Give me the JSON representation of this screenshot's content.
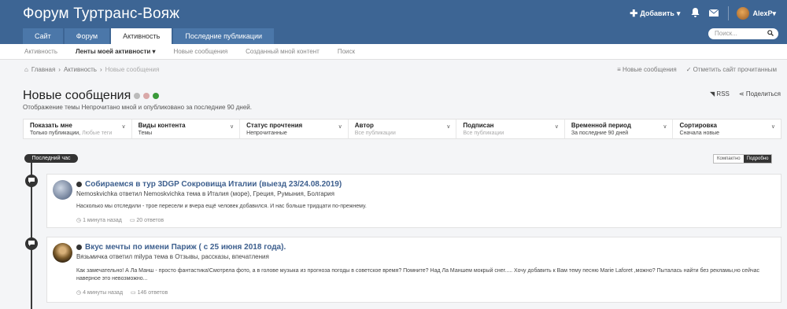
{
  "header": {
    "site_title": "Форум Туртранс-Вояж",
    "add_label": "Добавить",
    "username": "AlexP"
  },
  "nav": {
    "tabs": [
      {
        "label": "Сайт"
      },
      {
        "label": "Форум"
      },
      {
        "label": "Активность"
      },
      {
        "label": "Последние публикации"
      }
    ],
    "search_placeholder": "Поиск..."
  },
  "subnav": {
    "items": [
      {
        "label": "Активность"
      },
      {
        "label": "Ленты моей активности ▾"
      },
      {
        "label": "Новые сообщения"
      },
      {
        "label": "Созданный мной контент"
      },
      {
        "label": "Поиск"
      }
    ]
  },
  "breadcrumb": {
    "home": "Главная",
    "section": "Активность",
    "current": "Новые сообщения",
    "right_new": "Новые сообщения",
    "right_mark_read": "Отметить сайт прочитанным"
  },
  "page": {
    "title": "Новые сообщения",
    "subtitle": "Отображение темы Непрочитано мной и опубликовано за последние 90 дней.",
    "rss": "RSS",
    "share": "Поделиться"
  },
  "filters": [
    {
      "label": "Показать мне",
      "value": "Только публикации,",
      "value_muted": "Любые теги"
    },
    {
      "label": "Виды контента",
      "value": "Темы",
      "value_muted": ""
    },
    {
      "label": "Статус прочтения",
      "value": "Непрочитанные",
      "value_muted": ""
    },
    {
      "label": "Автор",
      "value": "",
      "value_muted": "Все публикации"
    },
    {
      "label": "Подписан",
      "value": "",
      "value_muted": "Все публикации"
    },
    {
      "label": "Временной период",
      "value": "За последние 90 дней",
      "value_muted": ""
    },
    {
      "label": "Сортировка",
      "value": "Сначала новые",
      "value_muted": ""
    }
  ],
  "timeline": {
    "badge": "Последний час",
    "view_compact": "Компактно",
    "view_detailed": "Подробно"
  },
  "posts": [
    {
      "title": "Собираемся в тур 3DGP Сокровища Италии (выезд 23/24.08.2019)",
      "meta": "Nemoskvichka ответил Nemoskvichka тема в Италия (море), Греция, Румыния, Болгария",
      "body": "Насколько мы отследили - трое пересели и вчера ещё человек добавился. И нас больше тридцати по-прежнему.",
      "time": "1 минута назад",
      "replies": "20 ответов"
    },
    {
      "title": "Вкус мечты по имени Париж ( с 25 июня 2018 года).",
      "meta": "Вязьмичка ответил milypa тема в Отзывы, рассказы, впечатления",
      "body": "Как замечательно! А Ла Манш - просто фантастика!Смотрела фото, а в голове музыка из прогноза погоды в советское время? Помните? Над Ла Маншем мокрый снег..... Хочу добавить к Вам тему песню Marie Laforet ,можно? Пыталась найти без рекламы,но сейчас наверное это невозможно...",
      "time": "4 минуты назад",
      "replies": "146 ответов"
    }
  ],
  "colors": {
    "header_bg": "#3d6594",
    "link": "#3d5f8e",
    "timeline": "#333333"
  }
}
